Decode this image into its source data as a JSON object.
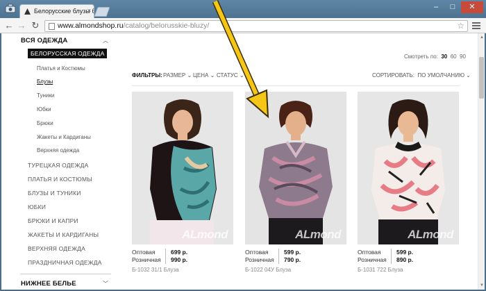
{
  "browser": {
    "tab_title": "Белорусские блузы больш",
    "url_host": "www.almondshop.ru",
    "url_path": "/catalog/belorusskie-bluzy/"
  },
  "sidebar": {
    "head_all": "ВСЯ ОДЕЖДА",
    "active_sub": "БЕЛОРУССКАЯ ОДЕЖДА",
    "sub_items": [
      "Платья и Костюмы",
      "Блузы",
      "Туники",
      "Юбки",
      "Брюки",
      "Жакеты и Кардиганы",
      "Верхняя одежда"
    ],
    "main_items": [
      "ТУРЕЦКАЯ ОДЕЖДА",
      "ПЛАТЬЯ И КОСТЮМЫ",
      "БЛУЗЫ И ТУНИКИ",
      "ЮБКИ",
      "БРЮКИ И КАПРИ",
      "ЖАКЕТЫ И КАРДИГАНЫ",
      "ВЕРХНЯЯ ОДЕЖДА",
      "ПРАЗДНИЧНАЯ ОДЕЖДА"
    ],
    "head_underwear": "НИЖНЕЕ БЕЛЬЕ"
  },
  "toolbar": {
    "perpage_label": "Смотреть по:",
    "perpage_opts": [
      "30",
      "60",
      "90"
    ],
    "filters_label": "ФИЛЬТРЫ:",
    "filter_size": "РАЗМЕР",
    "filter_price": "ЦЕНА",
    "filter_status": "СТАТУС",
    "sort_label": "СОРТИРОВАТЬ:",
    "sort_value": "ПО УМОЛЧАНИЮ"
  },
  "products": [
    {
      "label_wholesale": "Оптовая",
      "label_retail": "Розничная",
      "price_wholesale": "699 р.",
      "price_retail": "990 р.",
      "sku": "Б-1032 31/1 Блуза",
      "logo": "ALmond"
    },
    {
      "label_wholesale": "Оптовая",
      "label_retail": "Розничная",
      "price_wholesale": "599 р.",
      "price_retail": "790 р.",
      "sku": "Б-1022 04У Блуза",
      "logo": "ALmond"
    },
    {
      "label_wholesale": "Оптовая",
      "label_retail": "Розничная",
      "price_wholesale": "599 р.",
      "price_retail": "890 р.",
      "sku": "Б-1031 722 Блуза",
      "logo": "ALmond"
    }
  ],
  "colors": {
    "arrow": "#f5c518",
    "accent": "#111111"
  }
}
